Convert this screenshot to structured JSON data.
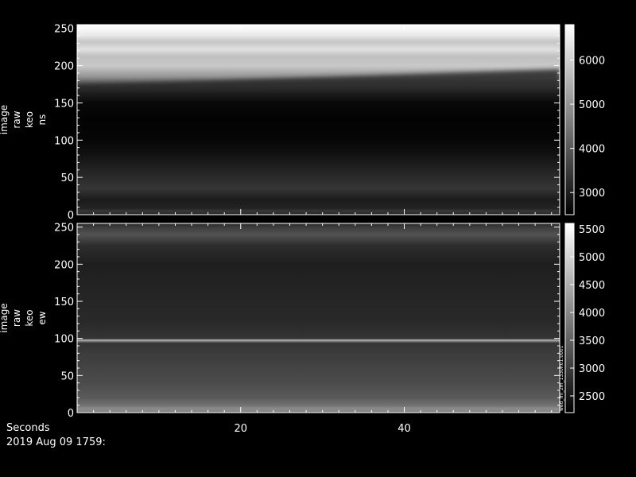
{
  "chart_data": [
    {
      "type": "heatmap",
      "ylabel": [
        "image",
        "raw",
        "keo",
        "ns"
      ],
      "x_ticks": [
        20,
        40
      ],
      "xlim": [
        0,
        59
      ],
      "y_ticks": [
        0,
        50,
        100,
        150,
        200,
        250
      ],
      "ylim": [
        0,
        255
      ],
      "colorbar_ticks": [
        3000,
        4000,
        5000,
        6000
      ],
      "colorbar_range": [
        2500,
        6800
      ],
      "colormap": "grayscale",
      "row_profile": [
        {
          "y": 0,
          "value": 3050
        },
        {
          "y": 5,
          "value": 3500
        },
        {
          "y": 8,
          "value": 3100
        },
        {
          "y": 20,
          "value": 2950
        },
        {
          "y": 35,
          "value": 3400
        },
        {
          "y": 55,
          "value": 3150
        },
        {
          "y": 80,
          "value": 2800
        },
        {
          "y": 100,
          "value": 2600
        },
        {
          "y": 130,
          "value": 2550
        },
        {
          "y": 150,
          "value": 2650
        },
        {
          "y": 170,
          "value": 3200
        },
        {
          "y": 185,
          "value": 5000
        },
        {
          "y": 200,
          "value": 5900
        },
        {
          "y": 212,
          "value": 5700
        },
        {
          "y": 222,
          "value": 6300
        },
        {
          "y": 232,
          "value": 5800
        },
        {
          "y": 240,
          "value": 6400
        },
        {
          "y": 250,
          "value": 6700
        },
        {
          "y": 255,
          "value": 6800
        }
      ],
      "edge_shift": {
        "start_y": 174,
        "end_y": 195
      }
    },
    {
      "type": "heatmap",
      "ylabel": [
        "image",
        "raw",
        "keo",
        "ew"
      ],
      "x_ticks": [
        20,
        40
      ],
      "xlim": [
        0,
        59
      ],
      "y_ticks": [
        0,
        50,
        100,
        150,
        200,
        250
      ],
      "ylim": [
        0,
        255
      ],
      "colorbar_ticks": [
        2500,
        3000,
        3500,
        4000,
        4500,
        5000,
        5500
      ],
      "colorbar_range": [
        2200,
        5600
      ],
      "colormap": "grayscale",
      "row_profile": [
        {
          "y": 0,
          "value": 3900
        },
        {
          "y": 5,
          "value": 4100
        },
        {
          "y": 10,
          "value": 3700
        },
        {
          "y": 20,
          "value": 3400
        },
        {
          "y": 40,
          "value": 3200
        },
        {
          "y": 60,
          "value": 3100
        },
        {
          "y": 80,
          "value": 3000
        },
        {
          "y": 95,
          "value": 2900
        },
        {
          "y": 97,
          "value": 5400
        },
        {
          "y": 99,
          "value": 2900
        },
        {
          "y": 120,
          "value": 2750
        },
        {
          "y": 150,
          "value": 2700
        },
        {
          "y": 180,
          "value": 2650
        },
        {
          "y": 200,
          "value": 2600
        },
        {
          "y": 225,
          "value": 2800
        },
        {
          "y": 240,
          "value": 3300
        },
        {
          "y": 250,
          "value": 3000
        },
        {
          "y": 255,
          "value": 2800
        }
      ],
      "edge_shift": {
        "start_y": 0,
        "end_y": 0
      },
      "vertical_annotation": "wed_fnl_2m_1330h01.0001"
    }
  ],
  "footer": {
    "axis_title": "Seconds",
    "date": "2019 Aug 09 1759:"
  }
}
